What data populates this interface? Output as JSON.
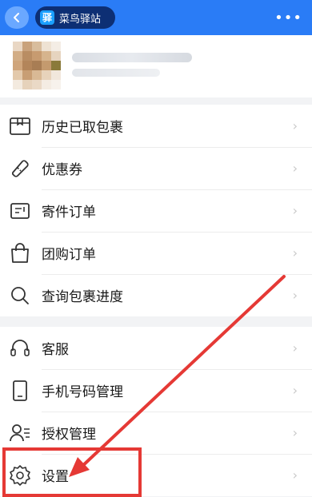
{
  "header": {
    "back_icon": "chevron-left-icon",
    "app_icon_char": "驿",
    "app_name": "菜鸟驿站",
    "more_icon": "more-icon",
    "more_glyph": "•••",
    "bar_color": "#2a7cf6"
  },
  "menu": {
    "group1": [
      {
        "label": "历史已取包裹",
        "icon": "package-history-icon"
      },
      {
        "label": "优惠券",
        "icon": "coupon-icon"
      },
      {
        "label": "寄件订单",
        "icon": "send-order-icon"
      },
      {
        "label": "团购订单",
        "icon": "shopping-bag-icon"
      },
      {
        "label": "查询包裹进度",
        "icon": "search-icon"
      }
    ],
    "group2": [
      {
        "label": "客服",
        "icon": "headset-icon"
      },
      {
        "label": "手机号码管理",
        "icon": "phone-icon"
      },
      {
        "label": "授权管理",
        "icon": "user-authorization-icon"
      },
      {
        "label": "设置",
        "icon": "gear-icon"
      }
    ],
    "chevron_glyph": "›"
  },
  "annotation": {
    "highlight_color": "#e53935",
    "arrow_color": "#e53935"
  }
}
